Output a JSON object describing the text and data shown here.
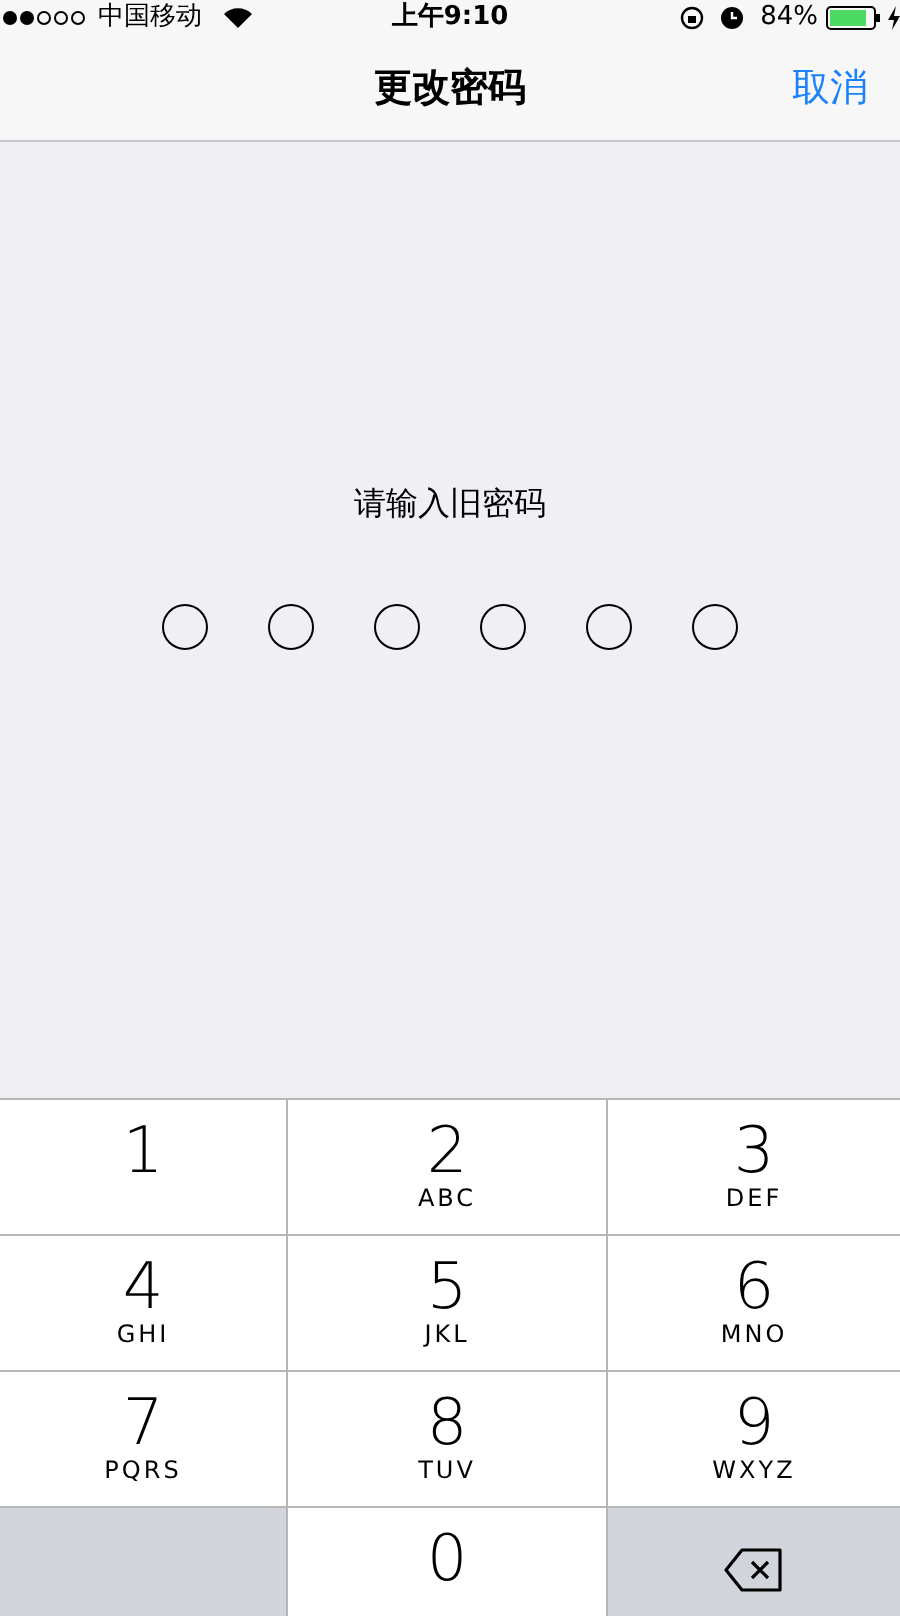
{
  "status_bar": {
    "carrier": "中国移动",
    "time": "上午9:10",
    "battery": "84%",
    "charging": true
  },
  "nav": {
    "title": "更改密码",
    "cancel": "取消"
  },
  "prompt": "请输入旧密码",
  "passcode_dots": [
    {
      "filled": false
    },
    {
      "filled": false
    },
    {
      "filled": false
    },
    {
      "filled": false
    },
    {
      "filled": false
    },
    {
      "filled": false
    }
  ],
  "keys": [
    {
      "kind": "digit",
      "digit": "1"
    },
    {
      "kind": "digit",
      "digit": "2",
      "letters": "ABC"
    },
    {
      "kind": "digit",
      "digit": "3",
      "letters": "DEF"
    },
    {
      "kind": "digit",
      "digit": "4",
      "letters": "GHI"
    },
    {
      "kind": "digit",
      "digit": "5",
      "letters": "JKL"
    },
    {
      "kind": "digit",
      "digit": "6",
      "letters": "MNO"
    },
    {
      "kind": "digit",
      "digit": "7",
      "letters": "PQRS"
    },
    {
      "kind": "digit",
      "digit": "8",
      "letters": "TUV"
    },
    {
      "kind": "digit",
      "digit": "9",
      "letters": "WXYZ"
    },
    {
      "kind": "blank"
    },
    {
      "kind": "digit",
      "digit": "0"
    },
    {
      "kind": "delete"
    }
  ]
}
